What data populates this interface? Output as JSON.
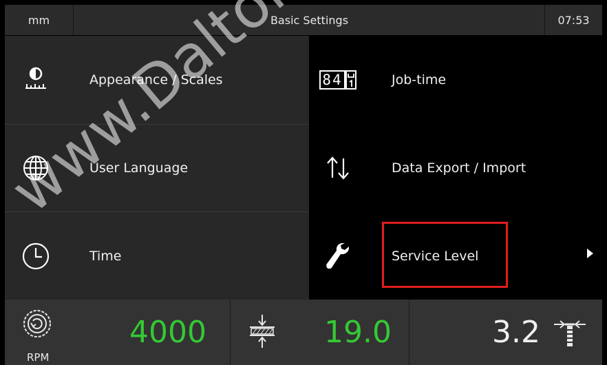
{
  "header": {
    "unit": "mm",
    "title": "Basic Settings",
    "time": "07:53"
  },
  "menu": {
    "appearance_label": "Appearance / Scales",
    "jobtime_label": "Job-time",
    "jobtime_icon_text": "84",
    "language_label": "User Language",
    "data_label": "Data Export / Import",
    "time_label": "Time",
    "service_label": "Service Level"
  },
  "status": {
    "rpm_value": "4000",
    "rpm_label": "RPM",
    "feed_value": "19.0",
    "depth_value": "3.2"
  },
  "watermark": "www.DaltonsWadkin.com",
  "colors": {
    "accent_green": "#34c934",
    "highlight_red": "#e11d1d",
    "header_bg": "#2b2b2b",
    "tile_dark": "#282828"
  }
}
